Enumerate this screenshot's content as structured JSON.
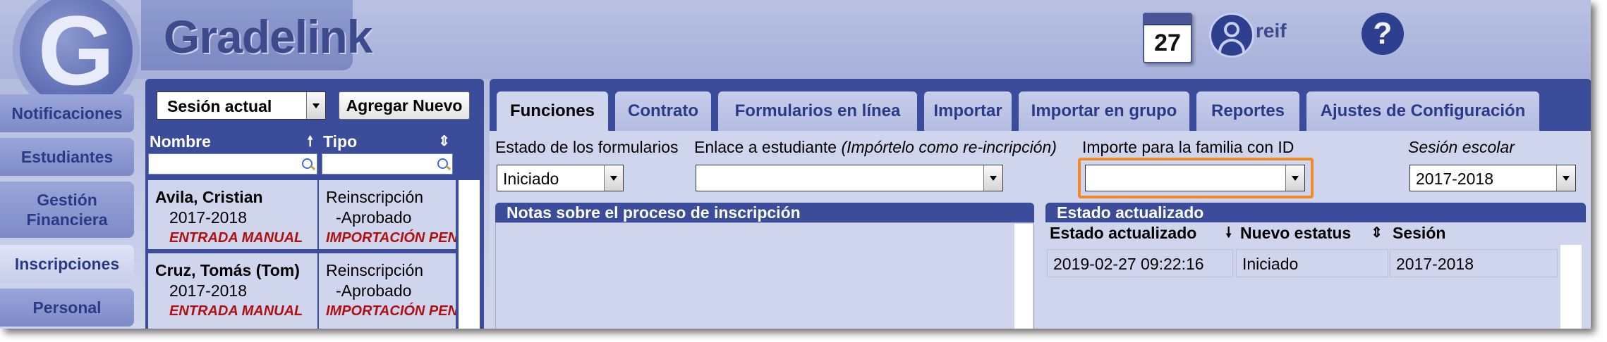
{
  "header": {
    "logo_letter": "G",
    "brand": "Gradelink",
    "calendar_day": "27",
    "user": "reif",
    "help": "?"
  },
  "nav": [
    "Notificaciones",
    "Estudiantes",
    "Gestión Financiera",
    "Inscripciones",
    "Personal"
  ],
  "list": {
    "session_select": "Sesión actual",
    "add_button": "Agregar Nuevo",
    "col_name": "Nombre",
    "col_type": "Tipo",
    "sort_up": "🠕",
    "sort_both": "⇕",
    "rows": [
      {
        "name": "Avila, Cristian",
        "year": "2017-2018",
        "source": "ENTRADA MANUAL",
        "type1": "Reinscripción",
        "type2": "-Aprobado",
        "import": "IMPORTACIÓN PEN"
      },
      {
        "name": "Cruz, Tomás (Tom)",
        "year": "2017-2018",
        "source": "ENTRADA MANUAL",
        "type1": "Reinscripción",
        "type2": "-Aprobado",
        "import": "IMPORTACIÓN PEN"
      }
    ]
  },
  "tabs": [
    "Funciones",
    "Contrato",
    "Formularios en línea",
    "Importar",
    "Importar en grupo",
    "Reportes",
    "Ajustes de Configuración"
  ],
  "form": {
    "estado_label": "Estado de los formularios",
    "estado_value": "Iniciado",
    "enlace_label": "Enlace a estudiante",
    "enlace_hint": "(Impórtelo como re-incripción)",
    "importe_label": "Importe para la familia con ID",
    "sesion_label": "Sesión escolar",
    "sesion_value": "2017-2018"
  },
  "notes": {
    "title": "Notas sobre el proceso de inscripción"
  },
  "status": {
    "title": "Estado actualizado",
    "col_date": "Estado actualizado",
    "col_status": "Nuevo estatus",
    "col_session": "Sesión",
    "sort_down": "🠗",
    "sort_both": "⇕",
    "rows": [
      {
        "date": "2019-02-27 09:22:16",
        "status": "Iniciado",
        "session": "2017-2018"
      }
    ]
  }
}
